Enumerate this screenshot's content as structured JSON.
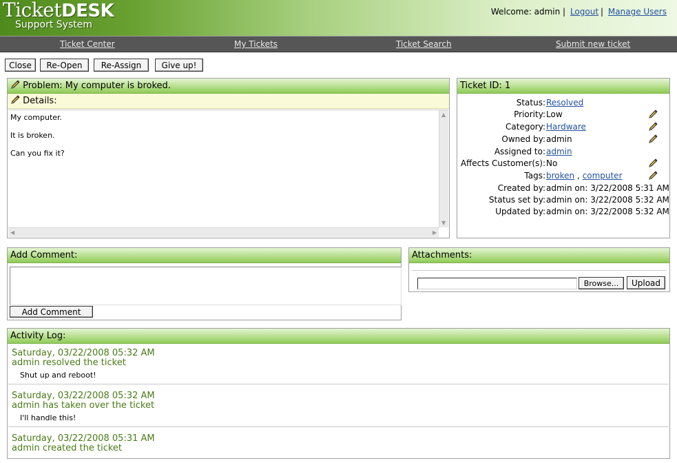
{
  "header": {
    "logo_title_prefix": "Ticket",
    "logo_title_bold": "DESK",
    "logo_subtitle": "Support System",
    "welcome": "Welcome: admin |",
    "logout": "Logout",
    "manage_users": "Manage Users"
  },
  "nav": {
    "ticket_center": "Ticket Center",
    "my_tickets": "My Tickets",
    "ticket_search": "Ticket Search",
    "submit_ticket": "Submit new ticket"
  },
  "actions": {
    "close": "Close",
    "reopen": "Re-Open",
    "reassign": "Re-Assign",
    "give_up": "Give up!"
  },
  "problem": {
    "title": "Problem: My computer is broked.",
    "details_label": "Details:",
    "lines": [
      "My computer.",
      "It is broken.",
      "Can you fix it?"
    ]
  },
  "ticket": {
    "id_label": "Ticket ID: 1",
    "status_label": "Status:",
    "status": "Resolved",
    "priority_label": "Priority:",
    "priority": "Low",
    "category_label": "Category:",
    "category": "Hardware",
    "owned_label": "Owned by:",
    "owned": "admin",
    "assigned_label": "Assigned to:",
    "assigned": "admin",
    "affects_label": "Affects Customer(s):",
    "affects": "No",
    "tags_label": "Tags:",
    "tag1": "broken",
    "tag_sep": ",",
    "tag2": "computer",
    "created_label": "Created by:",
    "created": "admin on: 3/22/2008 5:31 AM",
    "statusset_label": "Status set by:",
    "statusset": "admin on: 3/22/2008 5:32 AM",
    "updated_label": "Updated by:",
    "updated": "admin on: 3/22/2008 5:32 AM"
  },
  "comment": {
    "title": "Add Comment:",
    "value": "",
    "button": "Add Comment"
  },
  "attachments": {
    "title": "Attachments:",
    "browse": "Browse...",
    "upload": "Upload"
  },
  "activity": {
    "title": "Activity Log:",
    "entries": [
      {
        "date": "Saturday, 03/22/2008 05:32 AM",
        "action": "admin resolved the ticket",
        "comment": "Shut up and reboot!"
      },
      {
        "date": "Saturday, 03/22/2008 05:32 AM",
        "action": "admin has taken over the ticket",
        "comment": "I'll handle this!"
      },
      {
        "date": "Saturday, 03/22/2008 05:31 AM",
        "action": "admin created the ticket",
        "comment": ""
      }
    ]
  },
  "icons": {
    "pencil": "pencil-icon",
    "scroll_up": "scroll-up-arrow-icon",
    "scroll_down": "scroll-down-arrow-icon",
    "scroll_left": "scroll-left-arrow-icon",
    "scroll_right": "scroll-right-arrow-icon"
  },
  "colors": {
    "header_green": "#6aa232",
    "nav_gray": "#565656",
    "panel_head_green": "#b7df8e",
    "link_blue": "#2250a0",
    "log_green": "#4a7a16",
    "details_bg": "#fbfad8"
  }
}
